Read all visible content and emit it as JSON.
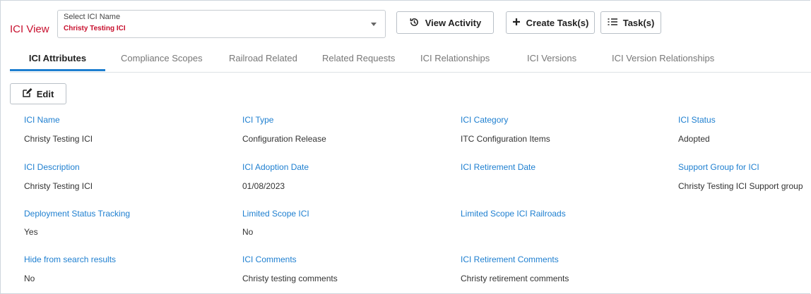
{
  "header": {
    "view_title": "ICI View",
    "select": {
      "label": "Select ICI Name",
      "value": "Christy Testing ICI"
    },
    "buttons": {
      "view_activity": "View Activity",
      "create_tasks": "Create Task(s)",
      "tasks": "Task(s)"
    }
  },
  "tabs": [
    {
      "label": "ICI Attributes",
      "active": true
    },
    {
      "label": "Compliance Scopes"
    },
    {
      "label": "Railroad Related"
    },
    {
      "label": "Related Requests"
    },
    {
      "label": "ICI Relationships"
    },
    {
      "label": "ICI Versions"
    },
    {
      "label": "ICI Version Relationships"
    }
  ],
  "edit_label": "Edit",
  "fields": [
    {
      "label": "ICI Name",
      "value": "Christy Testing ICI"
    },
    {
      "label": "ICI Type",
      "value": "Configuration Release"
    },
    {
      "label": "ICI Category",
      "value": "ITC Configuration Items"
    },
    {
      "label": "ICI Status",
      "value": "Adopted"
    },
    {
      "label": "ICI Description",
      "value": "Christy Testing ICI"
    },
    {
      "label": "ICI Adoption Date",
      "value": "01/08/2023"
    },
    {
      "label": "ICI Retirement Date",
      "value": ""
    },
    {
      "label": "Support Group for ICI",
      "value": "Christy Testing ICI Support group"
    },
    {
      "label": "Deployment Status Tracking",
      "value": "Yes"
    },
    {
      "label": "Limited Scope ICI",
      "value": "No"
    },
    {
      "label": "Limited Scope ICI Railroads",
      "value": ""
    },
    {
      "label": "Hide from search results",
      "value": "No"
    },
    {
      "label": "ICI Comments",
      "value": "Christy testing comments"
    },
    {
      "label": "ICI Retirement Comments",
      "value": "Christy retirement comments"
    }
  ],
  "colors": {
    "brand_red": "#c8102e",
    "link_blue": "#1e7fd0",
    "tab_active_underline": "#1e7fd0"
  },
  "icons": {
    "view_activity": "history-icon",
    "create_tasks": "plus-icon",
    "tasks": "list-icon",
    "edit": "edit-icon"
  }
}
